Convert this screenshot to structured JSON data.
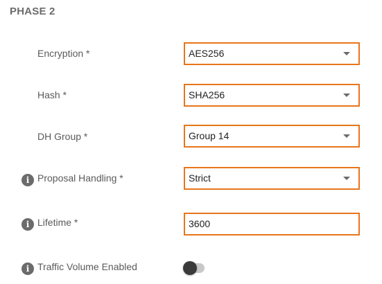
{
  "section": {
    "title": "PHASE 2"
  },
  "fields": {
    "encryption": {
      "label": "Encryption *",
      "value": "AES256"
    },
    "hash": {
      "label": "Hash *",
      "value": "SHA256"
    },
    "dh_group": {
      "label": "DH Group *",
      "value": "Group 14"
    },
    "proposal_handling": {
      "label": "Proposal Handling *",
      "value": "Strict"
    },
    "lifetime": {
      "label": "Lifetime *",
      "value": "3600"
    },
    "traffic_volume": {
      "label": "Traffic Volume Enabled",
      "enabled": false
    }
  },
  "icons": {
    "info": "info-icon",
    "dropdown": "chevron-down-icon"
  },
  "colors": {
    "field_border": "#e8751a",
    "label_text": "#5a5a5a",
    "title_text": "#6b6b6b",
    "toggle_off_track": "#c8c8c8",
    "toggle_knob": "#3a3a3a"
  },
  "info_glyph": "i"
}
